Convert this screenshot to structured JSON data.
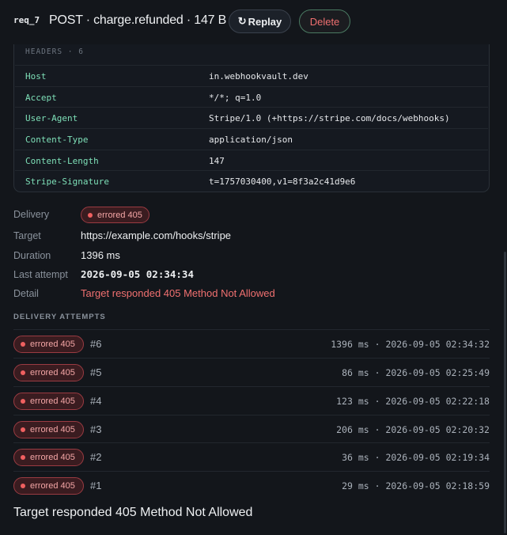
{
  "header": {
    "req_id": "req_7",
    "title": "POST · charge.refunded · 147 B",
    "replay_icon": "↻",
    "replay_label": "Replay",
    "delete_label": "Delete"
  },
  "headers_section": {
    "title": "HEADERS · 6",
    "rows": [
      {
        "key": "Host",
        "value": "in.webhookvault.dev"
      },
      {
        "key": "Accept",
        "value": "*/*; q=1.0"
      },
      {
        "key": "User-Agent",
        "value": "Stripe/1.0 (+https://stripe.com/docs/webhooks)"
      },
      {
        "key": "Content-Type",
        "value": "application/json"
      },
      {
        "key": "Content-Length",
        "value": "147"
      },
      {
        "key": "Stripe-Signature",
        "value": "t=1757030400,v1=8f3a2c41d9e6"
      }
    ]
  },
  "details": {
    "delivery_label": "Delivery",
    "delivery_badge": "errored 405",
    "target_label": "Target",
    "target_value": "https://example.com/hooks/stripe",
    "duration_label": "Duration",
    "duration_value": "1396 ms",
    "last_attempt_label": "Last attempt",
    "last_attempt_value": "2026-09-05 02:34:34",
    "detail_label": "Detail",
    "detail_value": "Target responded 405 Method Not Allowed"
  },
  "attempts_section": {
    "title": "DELIVERY ATTEMPTS",
    "attempts": [
      {
        "badge": "errored 405",
        "num": "#6",
        "meta": "1396 ms · 2026-09-05 02:34:32"
      },
      {
        "badge": "errored 405",
        "num": "#5",
        "meta": "86 ms · 2026-09-05 02:25:49"
      },
      {
        "badge": "errored 405",
        "num": "#4",
        "meta": "123 ms · 2026-09-05 02:22:18"
      },
      {
        "badge": "errored 405",
        "num": "#3",
        "meta": "206 ms · 2026-09-05 02:20:32"
      },
      {
        "badge": "errored 405",
        "num": "#2",
        "meta": "36 ms · 2026-09-05 02:19:34"
      },
      {
        "badge": "errored 405",
        "num": "#1",
        "meta": "29 ms · 2026-09-05 02:18:59"
      }
    ]
  },
  "footer": {
    "text": "Target responded 405 Method Not Allowed"
  },
  "colors": {
    "background": "#13161b",
    "header_key": "#7ee0b8",
    "error": "#f07070",
    "badge_bg": "#3a1c20"
  }
}
